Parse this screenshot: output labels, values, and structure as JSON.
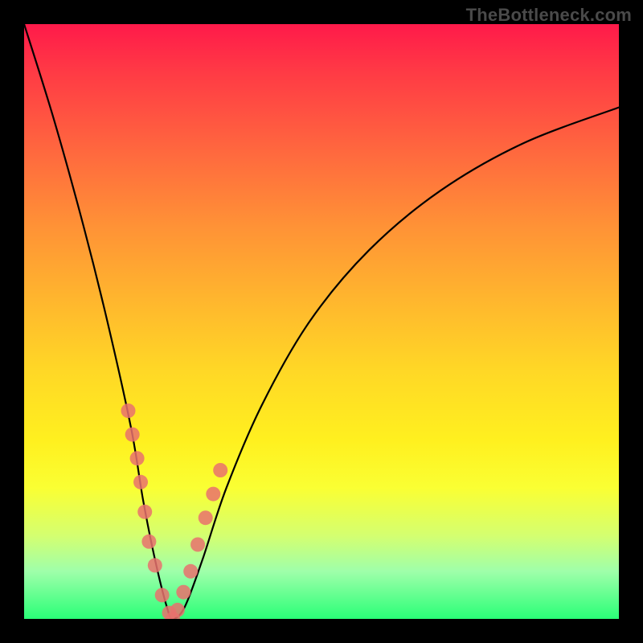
{
  "watermark": "TheBottleneck.com",
  "chart_data": {
    "type": "line",
    "title": "",
    "xlabel": "",
    "ylabel": "",
    "xlim": [
      0,
      100
    ],
    "ylim": [
      0,
      100
    ],
    "grid": false,
    "series": [
      {
        "name": "bottleneck-curve",
        "x": [
          0,
          5,
          10,
          14,
          18,
          20,
          22,
          24,
          25,
          27,
          30,
          34,
          40,
          48,
          58,
          70,
          84,
          100
        ],
        "values": [
          100,
          84,
          66,
          50,
          32,
          20,
          10,
          2,
          0,
          2,
          10,
          22,
          36,
          50,
          62,
          72,
          80,
          86
        ]
      }
    ],
    "markers": {
      "name": "highlight-dots",
      "x": [
        17.5,
        18.2,
        19.0,
        19.6,
        20.3,
        21.0,
        22.0,
        23.2,
        24.4,
        25.0,
        25.8,
        26.8,
        28.0,
        29.2,
        30.5,
        31.8,
        33.0
      ],
      "values": [
        35.0,
        31.0,
        27.0,
        23.0,
        18.0,
        13.0,
        9.0,
        4.0,
        1.0,
        0.0,
        1.5,
        4.5,
        8.0,
        12.5,
        17.0,
        21.0,
        25.0
      ]
    },
    "gradient_stops": [
      {
        "pos": 0,
        "color": "#ff1a4a"
      },
      {
        "pos": 22,
        "color": "#ff6a3e"
      },
      {
        "pos": 46,
        "color": "#ffb52e"
      },
      {
        "pos": 70,
        "color": "#fff01f"
      },
      {
        "pos": 86,
        "color": "#d4ff70"
      },
      {
        "pos": 100,
        "color": "#2aff77"
      }
    ]
  }
}
